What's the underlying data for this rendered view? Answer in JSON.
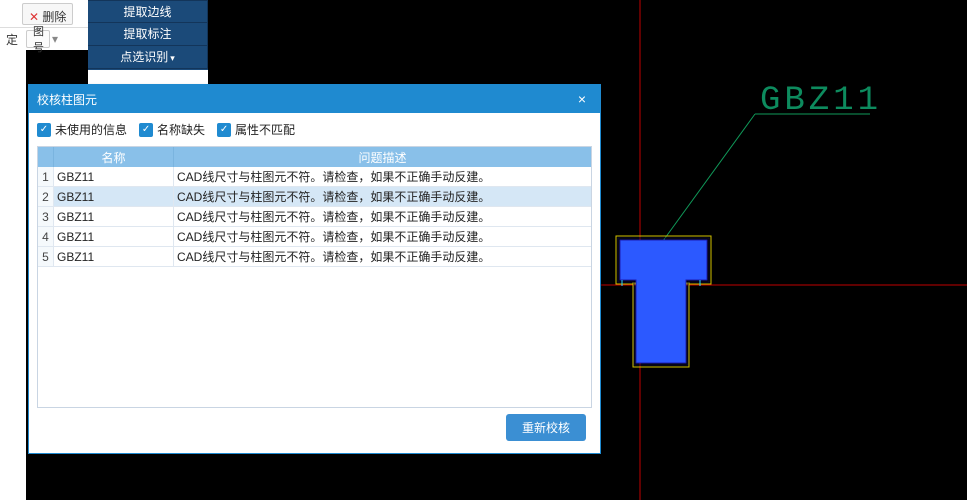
{
  "left_panel": {
    "delete": "删除",
    "fix": "定",
    "drawing_no": "图号",
    "dropdown": "▾"
  },
  "ribbon": {
    "extract_edge": "提取边线",
    "extract_annot": "提取标注",
    "point_select": "点选识别"
  },
  "dialog": {
    "title": "校核柱图元",
    "close": "×",
    "checks": {
      "unused_info": "未使用的信息",
      "name_missing": "名称缺失",
      "attr_mismatch": "属性不匹配"
    },
    "headers": {
      "name": "名称",
      "desc": "问题描述"
    },
    "rows": [
      {
        "idx": "1",
        "name": "GBZ11",
        "desc": "CAD线尺寸与柱图元不符。请检查，如果不正确手动反建。"
      },
      {
        "idx": "2",
        "name": "GBZ11",
        "desc": "CAD线尺寸与柱图元不符。请检查，如果不正确手动反建。"
      },
      {
        "idx": "3",
        "name": "GBZ11",
        "desc": "CAD线尺寸与柱图元不符。请检查，如果不正确手动反建。"
      },
      {
        "idx": "4",
        "name": "GBZ11",
        "desc": "CAD线尺寸与柱图元不符。请检查，如果不正确手动反建。"
      },
      {
        "idx": "5",
        "name": "GBZ11",
        "desc": "CAD线尺寸与柱图元不符。请检查，如果不正确手动反建。"
      }
    ],
    "recheck": "重新校核"
  },
  "cad": {
    "label": "GBZ11"
  }
}
